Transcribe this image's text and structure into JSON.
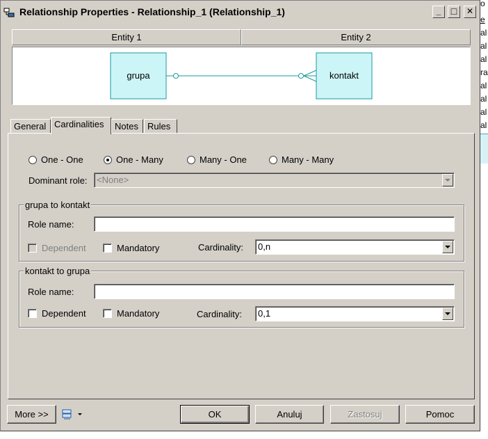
{
  "window": {
    "title": "Relationship Properties - Relationship_1 (Relationship_1)",
    "minimize": "_",
    "maximize": "□",
    "close": "✕"
  },
  "entities": {
    "header1": "Entity 1",
    "header2": "Entity 2",
    "entity1_name": "grupa",
    "entity2_name": "kontakt",
    "fill_color": "#ccf5f8",
    "line_color": "#1a9a9a"
  },
  "tabs": [
    {
      "label": "General"
    },
    {
      "label": "Cardinalities"
    },
    {
      "label": "Notes"
    },
    {
      "label": "Rules"
    }
  ],
  "active_tab": "Cardinalities",
  "cardinality_type": {
    "options": [
      "One - One",
      "One - Many",
      "Many - One",
      "Many - Many"
    ],
    "selected": "One - Many"
  },
  "dominant_role": {
    "label": "Dominant role:",
    "value": "<None>"
  },
  "group1": {
    "title": "grupa to kontakt",
    "role_label": "Role name:",
    "role_value": "",
    "dependent_label": "Dependent",
    "mandatory_label": "Mandatory",
    "cardinality_label": "Cardinality:",
    "cardinality_value": "0,n"
  },
  "group2": {
    "title": "kontakt to grupa",
    "role_label": "Role name:",
    "role_value": "",
    "dependent_label": "Dependent",
    "mandatory_label": "Mandatory",
    "cardinality_label": "Cardinality:",
    "cardinality_value": "0,1"
  },
  "buttons": {
    "more": "More >>",
    "ok": "OK",
    "cancel": "Anuluj",
    "apply": "Zastosuj",
    "help": "Pomoc"
  },
  "background_text": [
    "o",
    "e",
    "al",
    "al",
    "al",
    "ra",
    "al",
    "al",
    "al",
    "al"
  ]
}
